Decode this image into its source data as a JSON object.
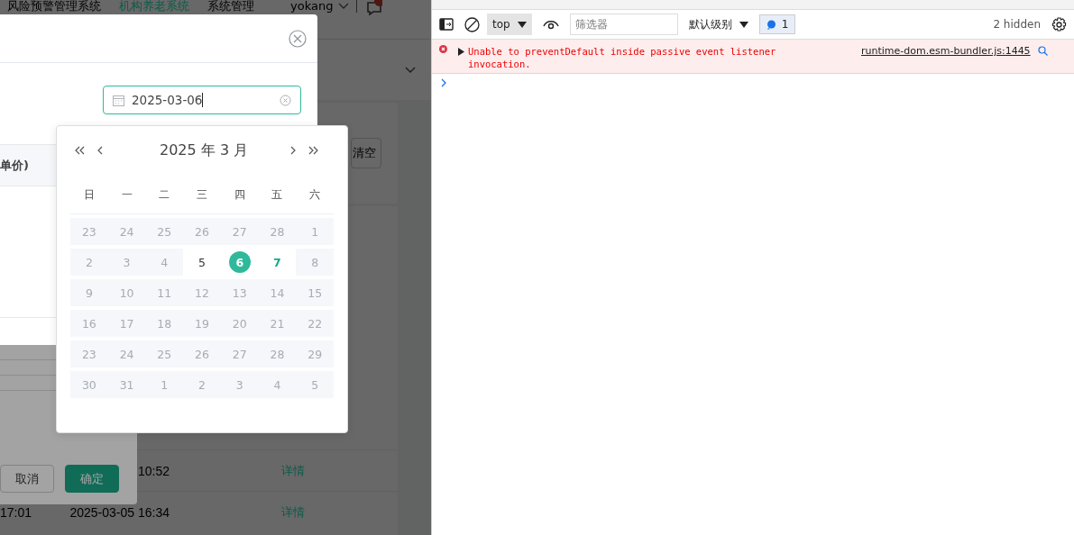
{
  "app": {
    "nav": [
      {
        "label": "风险预警管理系统",
        "selected": false
      },
      {
        "label": "机构养老系统",
        "selected": true
      },
      {
        "label": "系统管理",
        "selected": false
      }
    ],
    "user": "yokang",
    "clear_button": "清空",
    "rows": [
      {
        "time_a": "",
        "time_b": "10:52",
        "action": "详情"
      },
      {
        "time_a": "17:01",
        "time_b": "2025-03-05 16:34",
        "action": "详情"
      }
    ]
  },
  "back_dialog": {
    "buttons": [
      {
        "label": "取消",
        "kind": "plain"
      },
      {
        "label": "确定",
        "kind": "primary"
      }
    ]
  },
  "dialog": {
    "date_value": "2025-03-06",
    "column_header": "单价)"
  },
  "calendar": {
    "title": "2025 年  3 月",
    "weekdays": [
      "日",
      "一",
      "二",
      "三",
      "四",
      "五",
      "六"
    ],
    "weeks": [
      [
        {
          "text": "23",
          "disabled": true,
          "selected": false,
          "today": false
        },
        {
          "text": "24",
          "disabled": true,
          "selected": false,
          "today": false
        },
        {
          "text": "25",
          "disabled": true,
          "selected": false,
          "today": false
        },
        {
          "text": "26",
          "disabled": true,
          "selected": false,
          "today": false
        },
        {
          "text": "27",
          "disabled": true,
          "selected": false,
          "today": false
        },
        {
          "text": "28",
          "disabled": true,
          "selected": false,
          "today": false
        },
        {
          "text": "1",
          "disabled": true,
          "selected": false,
          "today": false
        }
      ],
      [
        {
          "text": "2",
          "disabled": true,
          "selected": false,
          "today": false
        },
        {
          "text": "3",
          "disabled": true,
          "selected": false,
          "today": false
        },
        {
          "text": "4",
          "disabled": true,
          "selected": false,
          "today": false
        },
        {
          "text": "5",
          "disabled": false,
          "selected": false,
          "today": false
        },
        {
          "text": "6",
          "disabled": false,
          "selected": true,
          "today": false
        },
        {
          "text": "7",
          "disabled": false,
          "selected": false,
          "today": true
        },
        {
          "text": "8",
          "disabled": true,
          "selected": false,
          "today": false
        }
      ],
      [
        {
          "text": "9",
          "disabled": true,
          "selected": false,
          "today": false
        },
        {
          "text": "10",
          "disabled": true,
          "selected": false,
          "today": false
        },
        {
          "text": "11",
          "disabled": true,
          "selected": false,
          "today": false
        },
        {
          "text": "12",
          "disabled": true,
          "selected": false,
          "today": false
        },
        {
          "text": "13",
          "disabled": true,
          "selected": false,
          "today": false
        },
        {
          "text": "14",
          "disabled": true,
          "selected": false,
          "today": false
        },
        {
          "text": "15",
          "disabled": true,
          "selected": false,
          "today": false
        }
      ],
      [
        {
          "text": "16",
          "disabled": true,
          "selected": false,
          "today": false
        },
        {
          "text": "17",
          "disabled": true,
          "selected": false,
          "today": false
        },
        {
          "text": "18",
          "disabled": true,
          "selected": false,
          "today": false
        },
        {
          "text": "19",
          "disabled": true,
          "selected": false,
          "today": false
        },
        {
          "text": "20",
          "disabled": true,
          "selected": false,
          "today": false
        },
        {
          "text": "21",
          "disabled": true,
          "selected": false,
          "today": false
        },
        {
          "text": "22",
          "disabled": true,
          "selected": false,
          "today": false
        }
      ],
      [
        {
          "text": "23",
          "disabled": true,
          "selected": false,
          "today": false
        },
        {
          "text": "24",
          "disabled": true,
          "selected": false,
          "today": false
        },
        {
          "text": "25",
          "disabled": true,
          "selected": false,
          "today": false
        },
        {
          "text": "26",
          "disabled": true,
          "selected": false,
          "today": false
        },
        {
          "text": "27",
          "disabled": true,
          "selected": false,
          "today": false
        },
        {
          "text": "28",
          "disabled": true,
          "selected": false,
          "today": false
        },
        {
          "text": "29",
          "disabled": true,
          "selected": false,
          "today": false
        }
      ],
      [
        {
          "text": "30",
          "disabled": true,
          "selected": false,
          "today": false
        },
        {
          "text": "31",
          "disabled": true,
          "selected": false,
          "today": false
        },
        {
          "text": "1",
          "disabled": true,
          "selected": false,
          "today": false
        },
        {
          "text": "2",
          "disabled": true,
          "selected": false,
          "today": false
        },
        {
          "text": "3",
          "disabled": true,
          "selected": false,
          "today": false
        },
        {
          "text": "4",
          "disabled": true,
          "selected": false,
          "today": false
        },
        {
          "text": "5",
          "disabled": true,
          "selected": false,
          "today": false
        }
      ]
    ]
  },
  "devtools": {
    "context": "top",
    "filter_placeholder": "筛选器",
    "level": "默认级别",
    "message_count": "1",
    "hidden": "2 hidden",
    "messages": [
      {
        "kind": "error",
        "text": "Unable to preventDefault inside passive event listener invocation.",
        "source": "runtime-dom.esm-bundler.js:1445"
      }
    ]
  }
}
